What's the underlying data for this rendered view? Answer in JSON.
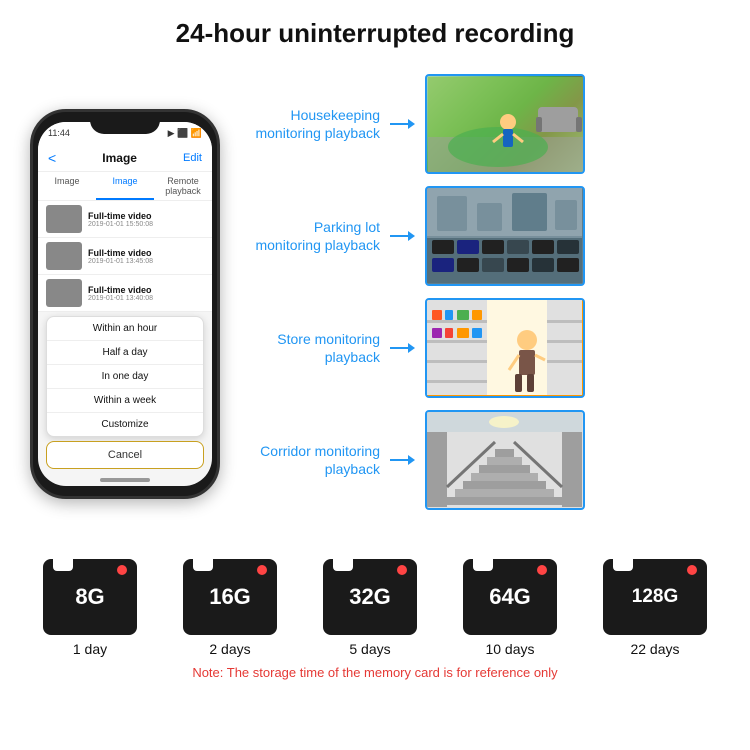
{
  "header": {
    "title": "24-hour uninterrupted recording"
  },
  "phone": {
    "time": "11:44",
    "nav": {
      "back": "<",
      "title": "Image",
      "edit": "Edit"
    },
    "tabs": [
      "Image",
      "Image",
      "Remote playback"
    ],
    "list_items": [
      {
        "title": "Full-time video",
        "date": "2019-01-01 15:50:08"
      },
      {
        "title": "Full-time video",
        "date": "2019-01-01 13:45:08"
      },
      {
        "title": "Full-time video",
        "date": "2019-01-01 13:40:08"
      }
    ],
    "dropdown_items": [
      "Within an hour",
      "Half a day",
      "In one day",
      "Within a week",
      "Customize"
    ],
    "cancel_label": "Cancel"
  },
  "monitoring": [
    {
      "label": "Housekeeping\nmonitoring playback",
      "img_class": "img-housekeeping"
    },
    {
      "label": "Parking lot\nmonitoring playback",
      "img_class": "img-parking"
    },
    {
      "label": "Store monitoring\nplayback",
      "img_class": "img-store"
    },
    {
      "label": "Corridor monitoring\nplayback",
      "img_class": "img-corridor"
    }
  ],
  "sd_cards": [
    {
      "size": "8G",
      "days": "1 day"
    },
    {
      "size": "16G",
      "days": "2 days"
    },
    {
      "size": "32G",
      "days": "5 days"
    },
    {
      "size": "64G",
      "days": "10 days"
    },
    {
      "size": "128G",
      "days": "22 days"
    }
  ],
  "note": "Note: The storage time of the memory card is for reference only"
}
